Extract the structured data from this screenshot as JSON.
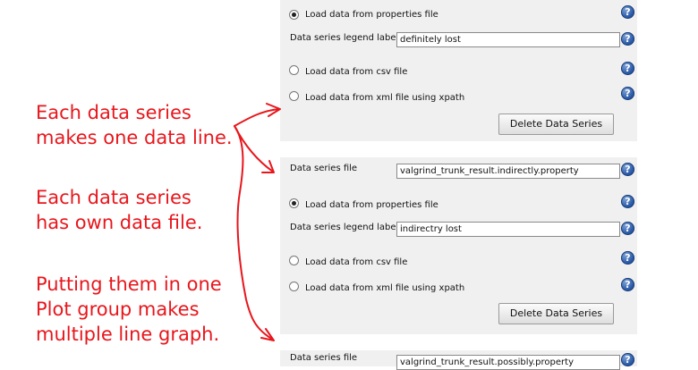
{
  "panels": [
    {
      "rows": {
        "opt_properties": "Load data from properties file",
        "legend_label": "Data series legend label",
        "legend_value": "definitely lost",
        "opt_csv": "Load data from csv file",
        "opt_xml": "Load data from xml file using xpath",
        "delete_button": "Delete Data Series"
      }
    },
    {
      "rows": {
        "file_label": "Data series file",
        "file_value": "valgrind_trunk_result.indirectly.property",
        "opt_properties": "Load data from properties file",
        "legend_label": "Data series legend label",
        "legend_value": "indirectry lost",
        "opt_csv": "Load data from csv file",
        "opt_xml": "Load data from xml file using xpath",
        "delete_button": "Delete Data Series"
      }
    },
    {
      "rows": {
        "file_label": "Data series file",
        "file_value": "valgrind_trunk_result.possibly.property"
      }
    }
  ],
  "help_glyph": "?",
  "annotations": {
    "block1": [
      "Each data series",
      "makes one data line."
    ],
    "block2": [
      "Each data series",
      "has own data file."
    ],
    "block3": [
      "Putting them in one",
      "Plot group makes",
      "multiple line graph."
    ]
  },
  "colors": {
    "annotation": "#e8161c",
    "panel": "#f0f0f0",
    "help": "#2a5aa8"
  }
}
